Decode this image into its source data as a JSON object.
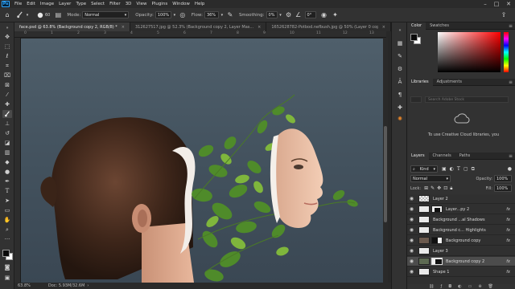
{
  "menu": {
    "logo": "Ps",
    "items": [
      "File",
      "Edit",
      "Image",
      "Layer",
      "Type",
      "Select",
      "Filter",
      "3D",
      "View",
      "Plugins",
      "Window",
      "Help"
    ],
    "window_controls": [
      "–",
      "□",
      "✕"
    ]
  },
  "options": {
    "mode_label": "Mode:",
    "mode_value": "Normal",
    "opacity_label": "Opacity:",
    "opacity_value": "100%",
    "flow_label": "Flow:",
    "flow_value": "36%",
    "smoothing_label": "Smoothing:",
    "smoothing_value": "0%",
    "angle_value": "0°",
    "brush_size": "60"
  },
  "tabs": [
    {
      "label": "face.psd @ 63.8% (Background copy 2, RGB/8) *",
      "close": "×"
    },
    {
      "label": "312627517.jpg @ 52.3% (Background copy 2, Layer Mas...",
      "close": "×"
    },
    {
      "label": "1652628782-Potbod.nefbush.jpg @ 50% (Layer 0 copy 2 ...",
      "close": "×"
    }
  ],
  "ruler": [
    "0",
    "1",
    "2",
    "3",
    "4",
    "5",
    "6",
    "7",
    "8",
    "9",
    "10",
    "11",
    "12",
    "13"
  ],
  "status": {
    "zoom": "63.8%",
    "doc": "Doc: 5.93M/32.6M"
  },
  "color_panel": {
    "tabs": [
      "Color",
      "Swatches"
    ],
    "foreground": "#0a0a0a",
    "background": "#ffffff",
    "hue": "#ff0000"
  },
  "libraries_panel": {
    "tabs": [
      "Libraries",
      "Adjustments"
    ],
    "search_placeholder": "Search Adobe Stock",
    "message": "To use Creative Cloud libraries, you"
  },
  "layers_panel": {
    "tabs": [
      "Layers",
      "Channels",
      "Paths"
    ],
    "filter_value": "Kind",
    "blend_value": "Normal",
    "opacity_label": "Opacity:",
    "opacity_value": "100%",
    "lock_label": "Lock:",
    "fill_label": "Fill:",
    "fill_value": "100%",
    "layers": [
      {
        "name": "Layer 2",
        "fx": "",
        "selected": false
      },
      {
        "name": "Layer...py 2",
        "fx": "fx",
        "selected": false
      },
      {
        "name": "Background ...al Shadows",
        "fx": "fx",
        "selected": false
      },
      {
        "name": "Background c... Highlights",
        "fx": "fx",
        "selected": false
      },
      {
        "name": "Background copy",
        "fx": "fx",
        "selected": false
      },
      {
        "name": "Layer 3",
        "fx": "",
        "selected": false
      },
      {
        "name": "Background copy 2",
        "fx": "fx",
        "selected": true
      },
      {
        "name": "Shape 1",
        "fx": "fx",
        "selected": false
      }
    ]
  },
  "colors": {
    "accent": "#31a8ff",
    "panel_bg": "#323232",
    "canvas_bg": "#4f5f6b"
  }
}
